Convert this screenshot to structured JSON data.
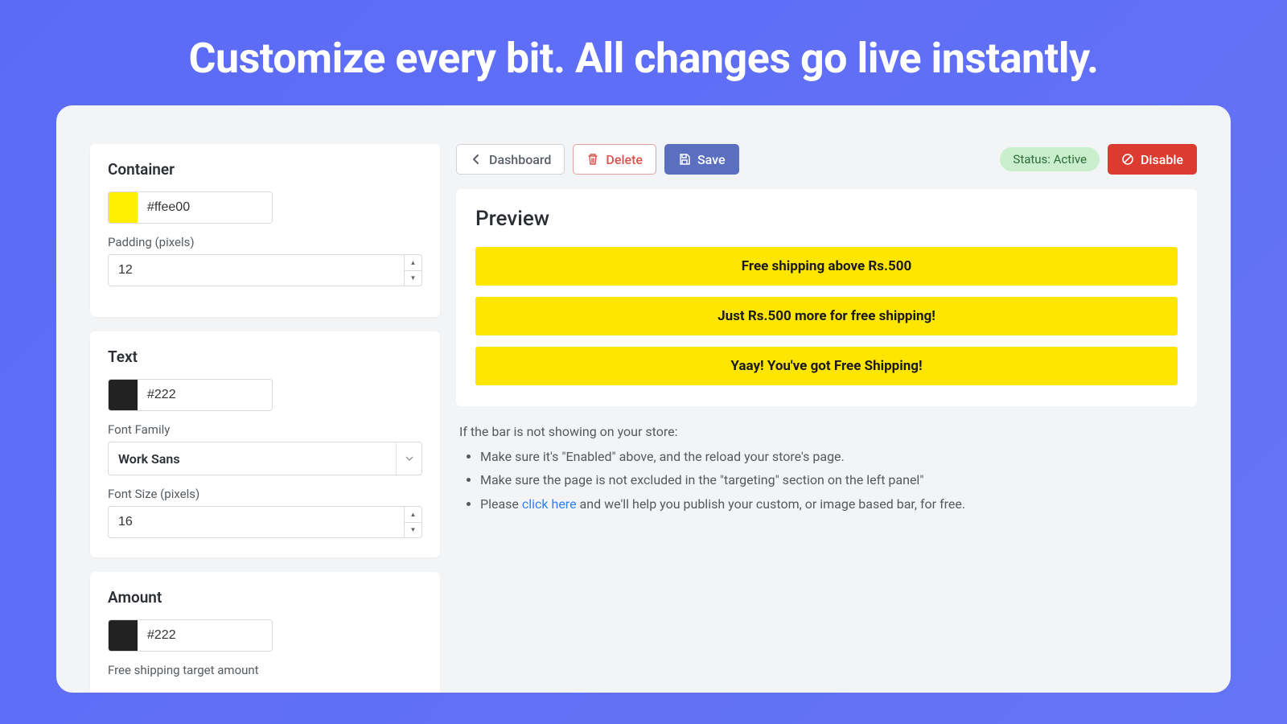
{
  "hero": {
    "title": "Customize every bit. All changes go live instantly."
  },
  "sidebar": {
    "container": {
      "title": "Container",
      "color": "#ffee00",
      "padding_label": "Padding (pixels)",
      "padding_value": "12"
    },
    "text": {
      "title": "Text",
      "color": "#222",
      "font_family_label": "Font Family",
      "font_family_value": "Work Sans",
      "font_size_label": "Font Size (pixels)",
      "font_size_value": "16"
    },
    "amount": {
      "title": "Amount",
      "color": "#222",
      "target_label": "Free shipping target amount"
    }
  },
  "toolbar": {
    "dashboard": "Dashboard",
    "delete": "Delete",
    "save": "Save",
    "status": "Status: Active",
    "disable": "Disable"
  },
  "preview": {
    "title": "Preview",
    "bars": [
      "Free shipping above Rs.500",
      "Just Rs.500 more for free shipping!",
      "Yaay! You've got Free Shipping!"
    ]
  },
  "help": {
    "intro": "If the bar is not showing on your store:",
    "items": [
      "Make sure it's \"Enabled\" above, and the reload your store's page.",
      "Make sure the page is not excluded in the \"targeting\" section on the left panel\""
    ],
    "please": "Please ",
    "link": "click here",
    "rest": " and we'll help you publish your custom, or image based bar, for free."
  }
}
